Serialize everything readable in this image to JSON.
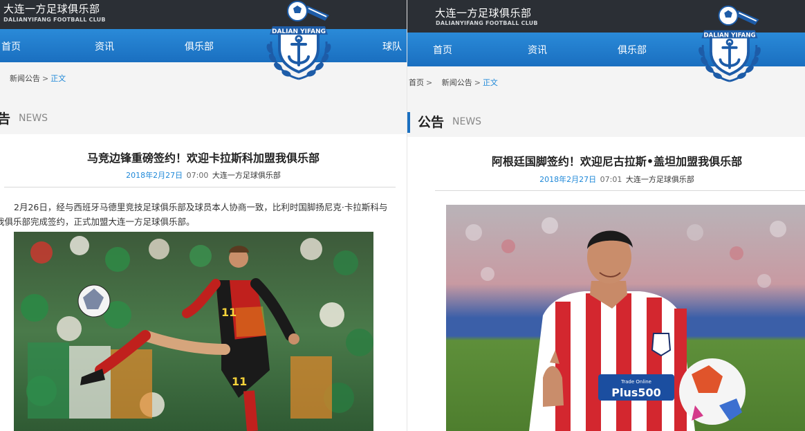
{
  "left": {
    "club_name": "大连一方足球俱乐部",
    "club_sub": "DALIANYIFANG FOOTBALL CLUB",
    "nav": [
      "首页",
      "资讯",
      "俱乐部",
      "球队"
    ],
    "logo_text": "DALIAN YIFANG",
    "breadcrumb": {
      "parent": "新闻公告",
      "sep": ">",
      "current": "正文"
    },
    "section": {
      "cn": "告",
      "en": "NEWS"
    },
    "article": {
      "title": "马竞边锋重磅签约！欢迎卡拉斯科加盟我俱乐部",
      "date": "2018年2月27日",
      "time": "07:00",
      "author": "大连一方足球俱乐部",
      "body_line1": "2月26日，经与西班牙马德里竞技足球俱乐部及球员本人协商一致，比利时国脚扬尼克·卡拉斯科与",
      "body_line2": "我俱乐部完成签约，正式加盟大连一方足球俱乐部。",
      "jersey_number": "11"
    }
  },
  "right": {
    "club_name": "大连一方足球俱乐部",
    "club_sub": "DALIANYIFANG FOOTBALL CLUB",
    "nav": [
      "首页",
      "资讯",
      "俱乐部"
    ],
    "logo_text": "DALIAN YIFANG",
    "breadcrumb": {
      "home": "首页",
      "sep1": ">",
      "parent": "新闻公告",
      "sep2": ">",
      "current": "正文"
    },
    "section": {
      "cn": "公告",
      "en": "NEWS"
    },
    "article": {
      "title": "阿根廷国脚签约！欢迎尼古拉斯•盖坦加盟我俱乐部",
      "date": "2018年2月27日",
      "time": "07:01",
      "author": "大连一方足球俱乐部",
      "sponsor": "Plus500",
      "sponsor_small": "Trade Online"
    }
  },
  "colors": {
    "topbar": "#2b2f35",
    "nav_blue": "#1a6fc0",
    "link_blue": "#1e88d8",
    "crumb_bg": "#f4f4f4"
  }
}
